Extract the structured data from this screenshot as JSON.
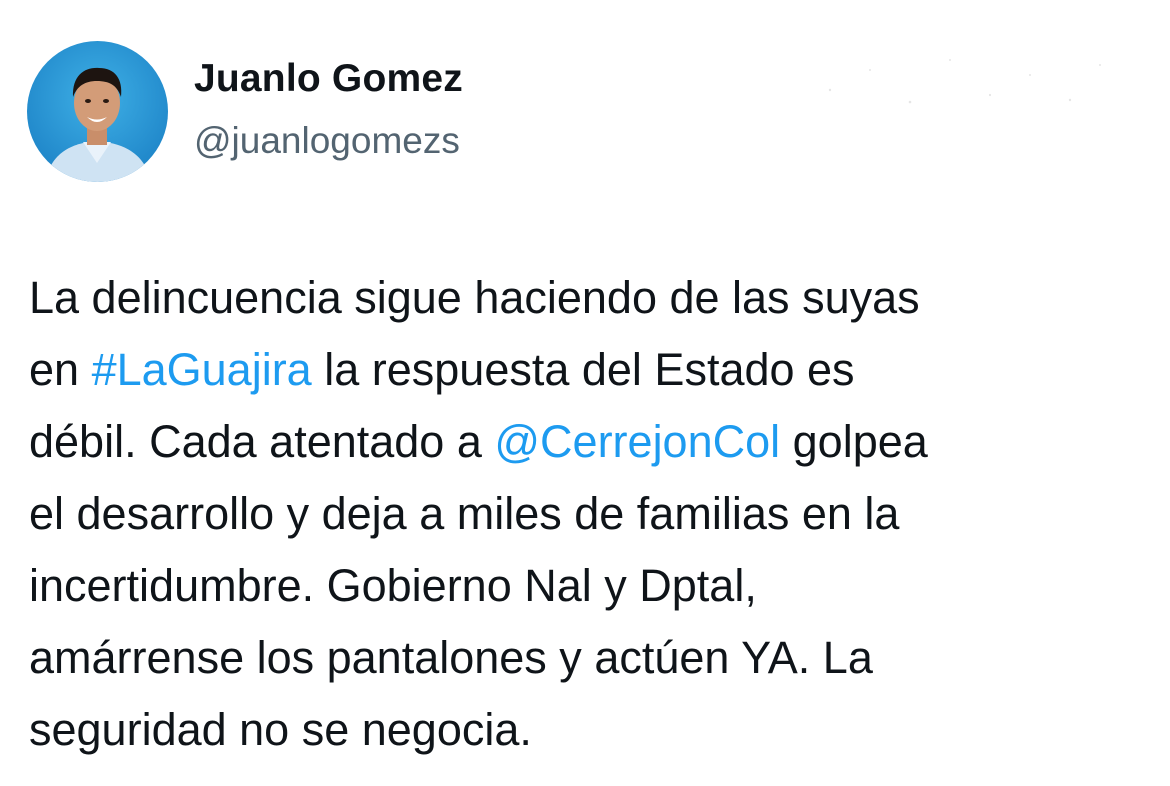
{
  "author": {
    "display_name": "Juanlo Gomez",
    "handle": "@juanlogomezs",
    "avatar_icon": "profile-photo"
  },
  "tweet": {
    "lines": [
      [
        {
          "text": "La delincuencia sigue haciendo de las suyas"
        }
      ],
      [
        {
          "text": "en "
        },
        {
          "text": "#LaGuajira",
          "link": true
        },
        {
          "text": " la respuesta del Estado es"
        }
      ],
      [
        {
          "text": "débil. Cada atentado a "
        },
        {
          "text": "@CerrejonCol",
          "link": true
        },
        {
          "text": " golpea"
        }
      ],
      [
        {
          "text": "el desarrollo y deja a miles de familias en la"
        }
      ],
      [
        {
          "text": "incertidumbre. Gobierno Nal y Dptal,"
        }
      ],
      [
        {
          "text": "amárrense los pantalones y actúen YA. La"
        }
      ],
      [
        {
          "text": "seguridad no se negocia."
        }
      ]
    ]
  },
  "colors": {
    "text": "#0f1419",
    "secondary": "#536471",
    "link": "#1d9bf0"
  }
}
